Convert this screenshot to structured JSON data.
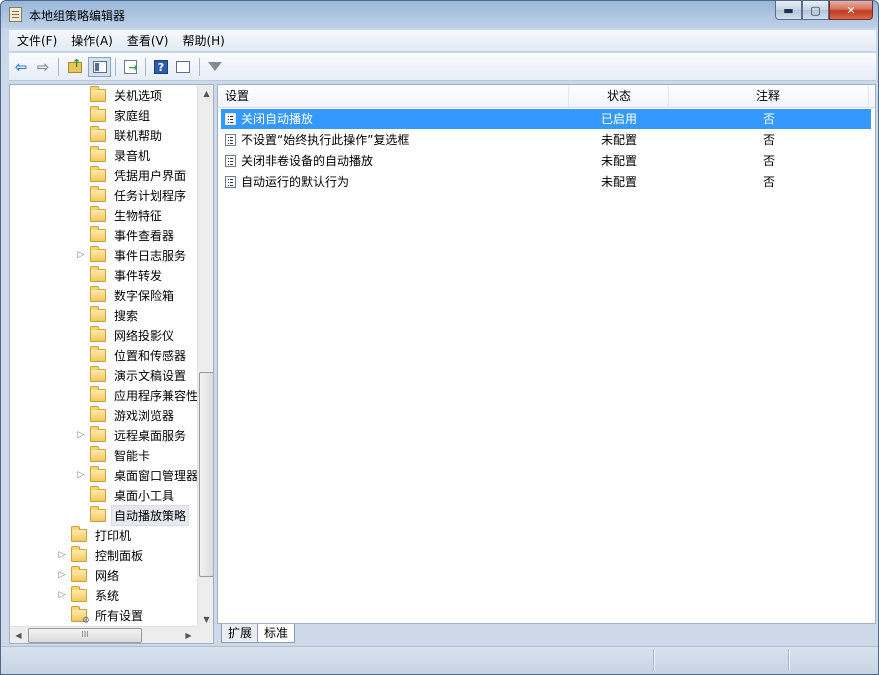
{
  "window": {
    "title": "本地组策略编辑器",
    "buttons": {
      "minimize": "▬",
      "maximize": "▢",
      "close": "✕"
    }
  },
  "menu": [
    {
      "label": "文件(F)"
    },
    {
      "label": "操作(A)"
    },
    {
      "label": "查看(V)"
    },
    {
      "label": "帮助(H)"
    }
  ],
  "toolbar": {
    "icons": [
      "back-icon",
      "forward-icon",
      "up-folder-icon",
      "show-hide-tree-icon",
      "export-list-icon",
      "help-icon",
      "extended-view-icon",
      "filter-icon"
    ]
  },
  "tree": {
    "items": [
      {
        "label": "关机选项",
        "expandable": false
      },
      {
        "label": "家庭组",
        "expandable": false
      },
      {
        "label": "联机帮助",
        "expandable": false
      },
      {
        "label": "录音机",
        "expandable": false
      },
      {
        "label": "凭据用户界面",
        "expandable": false
      },
      {
        "label": "任务计划程序",
        "expandable": false
      },
      {
        "label": "生物特征",
        "expandable": false
      },
      {
        "label": "事件查看器",
        "expandable": false
      },
      {
        "label": "事件日志服务",
        "expandable": true
      },
      {
        "label": "事件转发",
        "expandable": false
      },
      {
        "label": "数字保险箱",
        "expandable": false
      },
      {
        "label": "搜索",
        "expandable": false
      },
      {
        "label": "网络投影仪",
        "expandable": false
      },
      {
        "label": "位置和传感器",
        "expandable": false
      },
      {
        "label": "演示文稿设置",
        "expandable": false
      },
      {
        "label": "应用程序兼容性",
        "expandable": false
      },
      {
        "label": "游戏浏览器",
        "expandable": false
      },
      {
        "label": "远程桌面服务",
        "expandable": true
      },
      {
        "label": "智能卡",
        "expandable": false
      },
      {
        "label": "桌面窗口管理器",
        "expandable": true
      },
      {
        "label": "桌面小工具",
        "expandable": false
      },
      {
        "label": "自动播放策略",
        "expandable": false,
        "selected": true
      },
      {
        "label": "打印机",
        "expandable": false
      },
      {
        "label": "控制面板",
        "expandable": true
      },
      {
        "label": "网络",
        "expandable": true
      },
      {
        "label": "系统",
        "expandable": true
      },
      {
        "label": "所有设置",
        "expandable": false
      }
    ],
    "scroll_arrows": {
      "up": "▲",
      "down": "▼",
      "left": "◀",
      "right": "▶"
    },
    "hscroll_grip": "III"
  },
  "list": {
    "columns": {
      "setting": "设置",
      "state": "状态",
      "comment": "注释"
    },
    "rows": [
      {
        "setting": "关闭自动播放",
        "state": "已启用",
        "comment": "否",
        "selected": true
      },
      {
        "setting": "不设置“始终执行此操作”复选框",
        "state": "未配置",
        "comment": "否"
      },
      {
        "setting": "关闭非卷设备的自动播放",
        "state": "未配置",
        "comment": "否"
      },
      {
        "setting": "自动运行的默认行为",
        "state": "未配置",
        "comment": "否"
      }
    ]
  },
  "tabs": [
    {
      "label": "扩展",
      "active": false
    },
    {
      "label": "标准",
      "active": true
    }
  ],
  "colors": {
    "selection": "#3399ff",
    "title_bar": "#9ab7d8",
    "close_button": "#c2391f"
  }
}
